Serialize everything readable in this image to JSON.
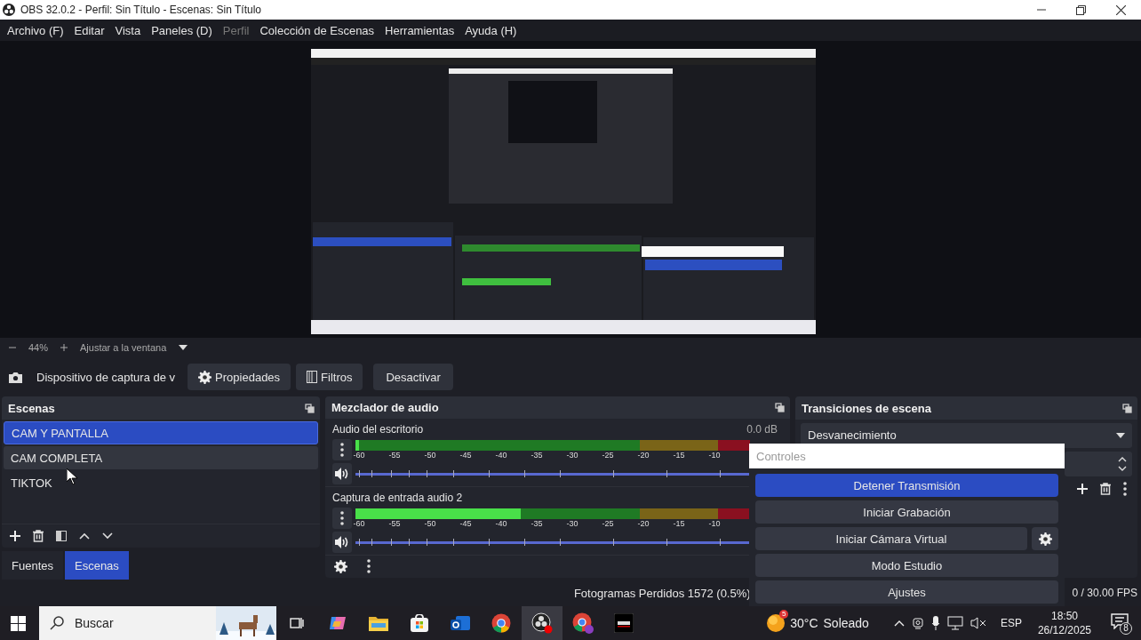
{
  "window": {
    "title": "OBS 32.0.2 - Perfil: Sin Título - Escenas: Sin Título"
  },
  "menu": [
    {
      "label": "Archivo (F)",
      "disabled": false
    },
    {
      "label": "Editar",
      "disabled": false
    },
    {
      "label": "Vista",
      "disabled": false
    },
    {
      "label": "Paneles (D)",
      "disabled": false
    },
    {
      "label": "Perfil",
      "disabled": true
    },
    {
      "label": "Colección de Escenas",
      "disabled": false
    },
    {
      "label": "Herramientas",
      "disabled": false
    },
    {
      "label": "Ayuda (H)",
      "disabled": false
    }
  ],
  "preview": {
    "kind": "picture",
    "zoom": "44%",
    "fit": "Ajustar a la ventana"
  },
  "source_toolbar": {
    "source": "Dispositivo de captura de v",
    "buttons": [
      {
        "label": "Propiedades",
        "kind": "gear"
      },
      {
        "label": "Filtros",
        "kind": "filter"
      },
      {
        "label": "Desactivar",
        "kind": "plain"
      }
    ]
  },
  "scenes": {
    "title": "Escenas",
    "items": [
      {
        "label": "CAM Y PANTALLA",
        "selected": true,
        "hovered": false
      },
      {
        "label": "CAM COMPLETA",
        "selected": false,
        "hovered": true
      },
      {
        "label": "TIKTOK",
        "selected": false,
        "hovered": false
      }
    ]
  },
  "dock_tabs": [
    {
      "label": "Fuentes",
      "selected": false
    },
    {
      "label": "Escenas",
      "selected": true
    }
  ],
  "mixer": {
    "title": "Mezclador de audio",
    "channels": [
      {
        "name": "Audio del escritorio",
        "reading": "0.0 dB",
        "level": 0.01,
        "scale": [
          "-60",
          "-55",
          "-50",
          "-45",
          "-40",
          "-35",
          "-30",
          "-25",
          "-20",
          "-15",
          "-10"
        ]
      },
      {
        "name": "Captura de entrada audio 2",
        "level": 0.42,
        "scale": [
          "-60",
          "-55",
          "-50",
          "-45",
          "-40",
          "-35",
          "-30",
          "-25",
          "-20",
          "-15",
          "-10"
        ]
      }
    ]
  },
  "transitions": {
    "title": "Transiciones de escena",
    "selected": "Desvanecimiento"
  },
  "controls": {
    "title": "Controles",
    "buttons": [
      {
        "label": "Detener Transmisión",
        "active": true,
        "kind": "plain"
      },
      {
        "label": "Iniciar Grabación",
        "active": false,
        "kind": "plain"
      },
      {
        "label": "Iniciar Cámara Virtual",
        "active": false,
        "kind": "settings"
      },
      {
        "label": "Modo Estudio",
        "active": false,
        "kind": "plain"
      },
      {
        "label": "Ajustes",
        "active": false,
        "kind": "plain"
      }
    ]
  },
  "status_bar": {
    "dropped": "Fotogramas Perdidos 1572 (0.5%)",
    "fps": "0 / 30.00 FPS"
  },
  "taskbar": {
    "search": {
      "placeholder": "Buscar"
    },
    "weather": {
      "badge": "5",
      "temperature": "30°C",
      "condition": "Soleado"
    },
    "language": "ESP",
    "time": "18:50",
    "date": "26/12/2025",
    "notifications": "8"
  }
}
